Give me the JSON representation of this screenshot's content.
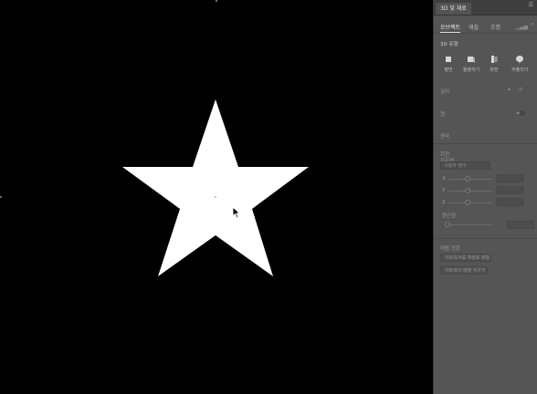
{
  "panel": {
    "tab_title": "3D 및 재료",
    "menu_icon": "menu-icon",
    "subtabs": [
      "오브젝트",
      "재질",
      "조명"
    ],
    "section_title": "3D 유형",
    "tools": [
      {
        "label": "평면",
        "icon": "plane-icon"
      },
      {
        "label": "돌출하기",
        "icon": "extrude-icon"
      },
      {
        "label": "회전",
        "icon": "revolve-icon"
      },
      {
        "label": "부풀리기",
        "icon": "inflate-icon"
      }
    ],
    "depth_label": "깊이",
    "cap_label": "캡",
    "bevel_label": "경사",
    "rotation_label": "회전",
    "preset_label": "프리셋",
    "preset_value": "사용자 정의",
    "axis_x": "X",
    "axis_y": "Y",
    "axis_z": "Z",
    "perspective_label": "원근감",
    "mapping_label": "매핑 전환",
    "btn_artwork_map": "아트워크를 재질로 매핑",
    "btn_clear": "아트워크 매핑 지우기"
  },
  "colors": {
    "canvas": "#000000",
    "panel": "#555555",
    "star": "#ffffff"
  }
}
